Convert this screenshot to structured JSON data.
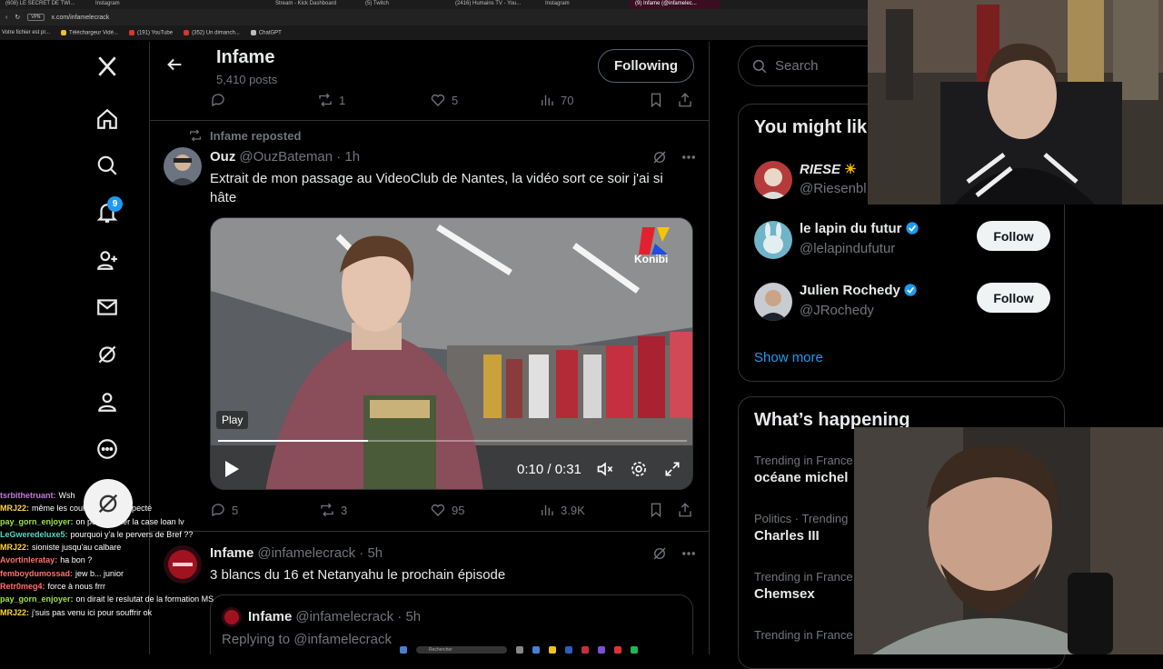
{
  "browser": {
    "tabs": [
      "(608) LE SECRET DE TWI...",
      "Instagram",
      "",
      "Stream - Kick Dashboard",
      "(5) Twitch",
      "(2416) Humains TV - You...",
      "Instagram",
      "(9) Infame (@infamelec..."
    ],
    "url": "x.com/infamelecrack",
    "vpn": "VPN",
    "bookmarks": [
      "Votre fichier est pr...",
      "Téléchargeur Vidé...",
      "(191) YouTube",
      "(352) Un dimanch...",
      "ChatGPT"
    ]
  },
  "nav": {
    "notifications_badge": "9"
  },
  "header": {
    "title": "Infame",
    "posts": "5,410 posts",
    "follow_label": "Following"
  },
  "top_actions": {
    "replies": "",
    "reposts": "1",
    "likes": "5",
    "views": "70"
  },
  "tweet1": {
    "repost_label": "Infame reposted",
    "name": "Ouz",
    "handle": "@OuzBateman · 1h",
    "text": "Extrait de mon passage au VideoClub de Nantes, la vidéo sort ce soir j'ai si hâte",
    "video": {
      "tooltip": "Play",
      "time": "0:10 / 0:31",
      "progress": 0.32,
      "logo": "Konibi"
    },
    "actions": {
      "replies": "5",
      "reposts": "3",
      "likes": "95",
      "views": "3.9K"
    }
  },
  "tweet2": {
    "name": "Infame",
    "handle": "@infamelecrack · 5h",
    "text": "3 blancs du 16 et  Netanyahu le prochain épisode",
    "quote": {
      "name": "Infame",
      "handle": "@infamelecrack · 5h",
      "reply": "Replying to @infamelecrack"
    }
  },
  "right": {
    "search_placeholder": "Search",
    "suggest_title": "You might lik",
    "suggestions": [
      {
        "name": "RIESE",
        "handle": "@Riesenbl",
        "follow": ""
      },
      {
        "name": "le lapin du futur",
        "handle": "@lelapindufutur",
        "follow": "Follow"
      },
      {
        "name": "Julien Rochedy",
        "handle": "@JRochedy",
        "follow": "Follow"
      }
    ],
    "show_more": "Show more",
    "happening_title": "What’s happening",
    "trends": [
      {
        "meta": "Trending in France",
        "name": "océane michel"
      },
      {
        "meta": "Politics · Trending",
        "name": "Charles III"
      },
      {
        "meta": "Trending in France",
        "name": "Chemsex"
      },
      {
        "meta": "Trending in France",
        "name": ""
      }
    ]
  },
  "chat": [
    {
      "name": "tsrbithetruant:",
      "msg": "Wsh",
      "color": "#c678dd"
    },
    {
      "name": "MRJ22:",
      "msg": "même les couleurs sont respecté",
      "color": "#ffd447"
    },
    {
      "name": "pay_gorn_enjoyer:",
      "msg": "on peut cocher la case loan lv",
      "color": "#9ee34b"
    },
    {
      "name": "LeGweredeluxe5:",
      "msg": "pourquoi y'a le pervers de Bref ??",
      "color": "#5ad7c7"
    },
    {
      "name": "MRJ22:",
      "msg": "sioniste jusqu'au calbare",
      "color": "#ffd447"
    },
    {
      "name": "Avortinleratay:",
      "msg": "ha bon ?",
      "color": "#ff7070"
    },
    {
      "name": "femboydumossad:",
      "msg": "jew b... junior",
      "color": "#ff7070"
    },
    {
      "name": "Retr0meg4:",
      "msg": "force à nous frrr",
      "color": "#ff7070"
    },
    {
      "name": "pay_gorn_enjoyer:",
      "msg": "on dirait le reslutat de la formation MS",
      "color": "#9ee34b"
    },
    {
      "name": "MRJ22:",
      "msg": "j'suis pas venu ici pour souffrir ok",
      "color": "#ffd447"
    }
  ],
  "taskbar": {
    "search": "Rechercher"
  }
}
